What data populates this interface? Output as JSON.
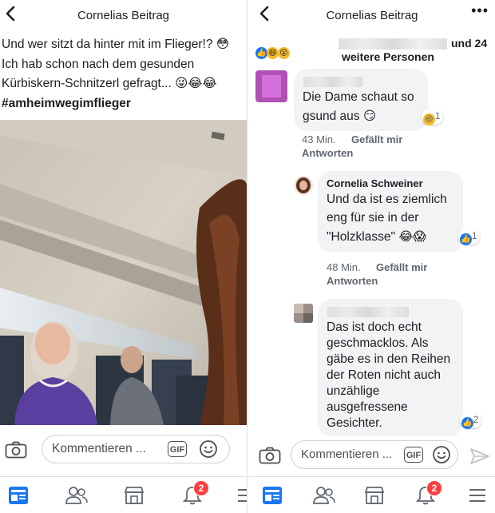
{
  "left": {
    "header": {
      "title": "Cornelias Beitrag"
    },
    "post": {
      "line1": "Und wer sitzt da hinter mit im Flieger!? 😳",
      "line2": "Ich hab schon nach dem gesunden",
      "line3": "Kürbiskern-Schnitzerl gefragt... 😜😂😂",
      "hashtag": "#amheimwegimflieger"
    },
    "comment_box": {
      "placeholder": "Kommentieren ...",
      "gif_label": "GIF"
    },
    "nav": {
      "notifications_badge": "2"
    }
  },
  "right": {
    "header": {
      "title": "Cornelias Beitrag",
      "more": "•••"
    },
    "reactions": {
      "others_line1": "und 24",
      "others_line2": "weitere Personen"
    },
    "comments": [
      {
        "text_line1": "Die Dame schaut so",
        "text_line2": "gsund aus 😏",
        "reaction_count": "1",
        "time": "43 Min.",
        "like": "Gefällt mir",
        "reply": "Antworten"
      },
      {
        "author": "Cornelia Schweiner",
        "text_line1": "Und da ist es ziemlich",
        "text_line2": "eng für sie in der",
        "text_line3": "\"Holzklasse\" 😂😱",
        "reaction_count": "1",
        "time": "48 Min.",
        "like": "Gefällt mir",
        "reply": "Antworten"
      },
      {
        "text_line1": "Das ist doch echt",
        "text_line2": "geschmacklos. Als",
        "text_line3": "gäbe es in den Reihen",
        "text_line4": "der Roten nicht auch",
        "text_line5": "unzählige",
        "text_line6": "ausgefressene",
        "text_line7": "Gesichter.",
        "reaction_count": "2"
      }
    ],
    "comment_box": {
      "placeholder": "Kommentieren ...",
      "gif_label": "GIF"
    },
    "nav": {
      "notifications_badge": "2"
    }
  },
  "colors": {
    "accent": "#1877f2",
    "badge": "#fa3e3e",
    "bubble": "#f2f3f5",
    "meta": "#606770"
  },
  "icons": [
    "back-arrow-icon",
    "camera-icon",
    "gif-icon",
    "smiley-icon",
    "send-icon",
    "feed-icon",
    "friends-icon",
    "marketplace-icon",
    "bell-icon",
    "menu-icon",
    "more-icon"
  ]
}
